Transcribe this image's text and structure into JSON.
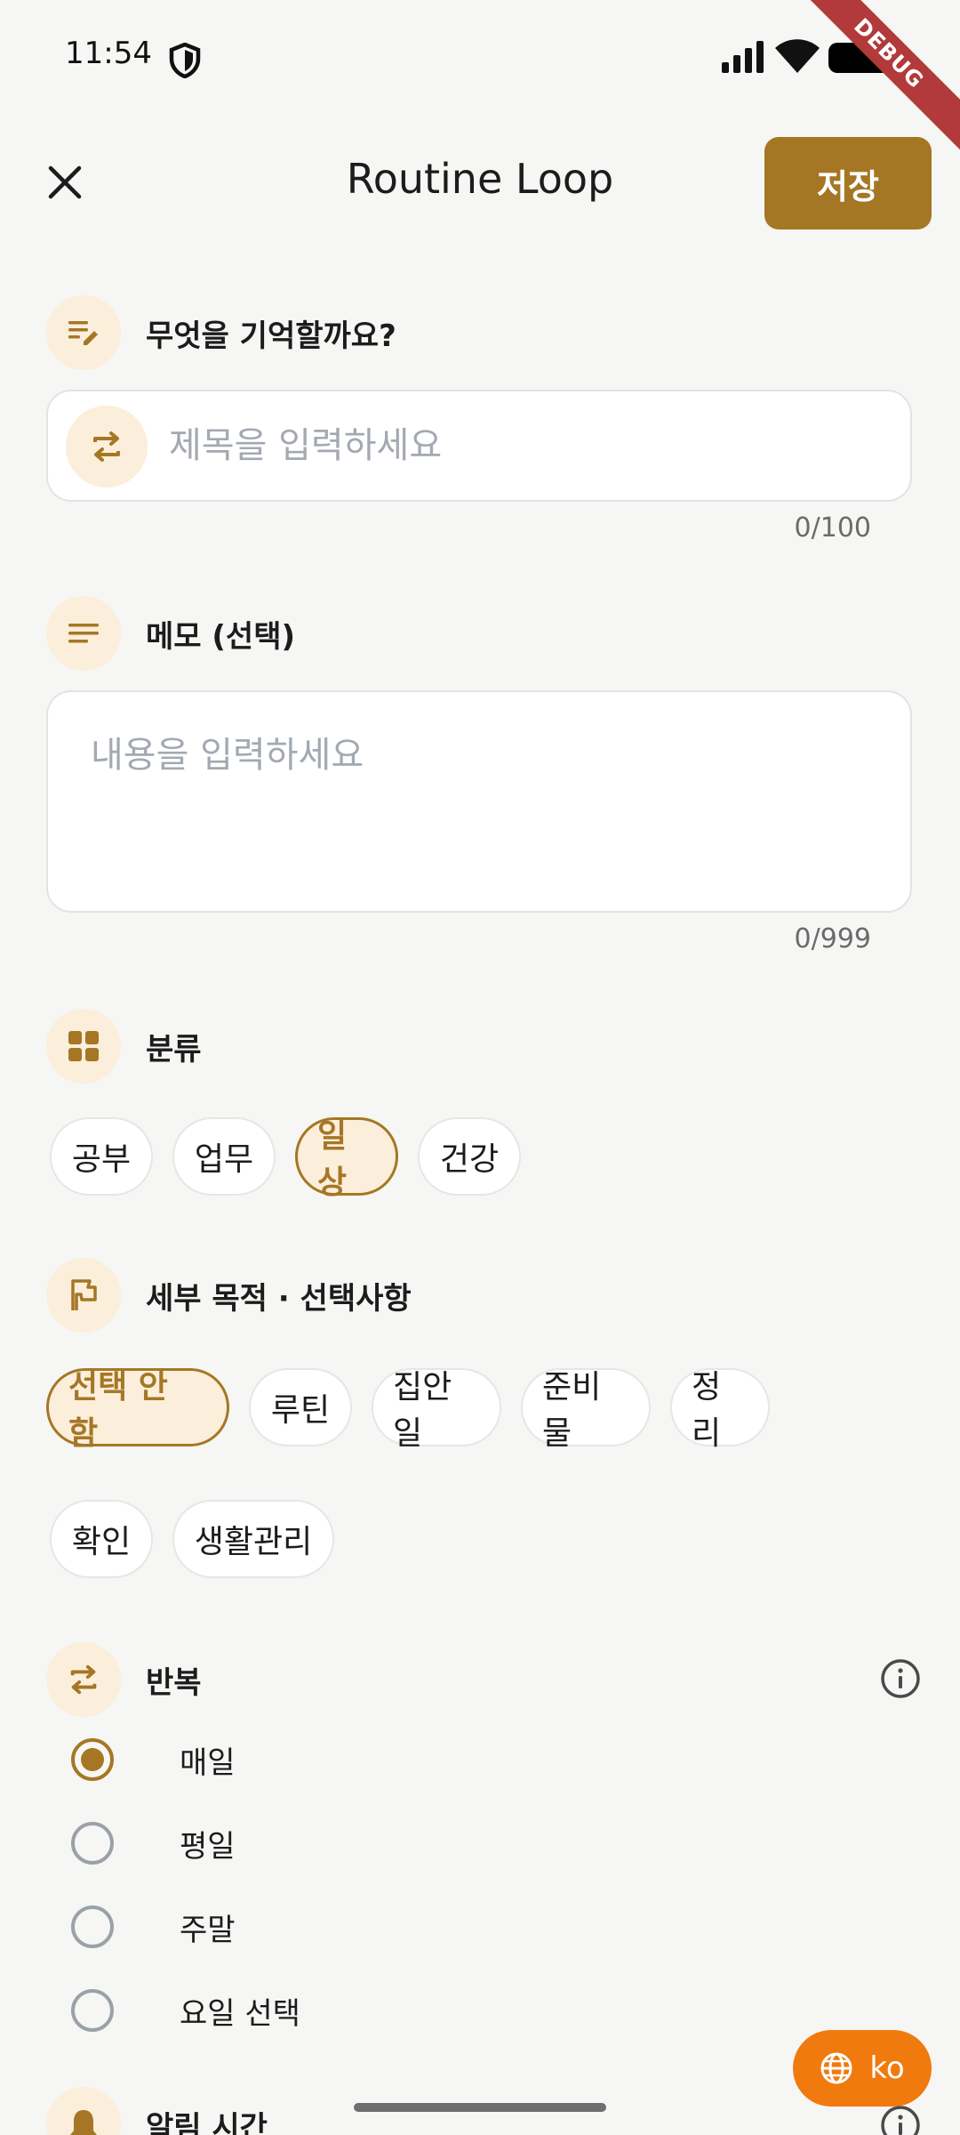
{
  "status_bar": {
    "time": "11:54"
  },
  "debug_banner": "DEBUG",
  "app_bar": {
    "title": "Routine Loop",
    "save_label": "저장"
  },
  "title_section": {
    "label": "무엇을 기억할까요?",
    "placeholder": "제목을 입력하세요",
    "value": "",
    "counter": "0/100"
  },
  "memo_section": {
    "label": "메모 (선택)",
    "placeholder": "내용을 입력하세요",
    "value": "",
    "counter": "0/999"
  },
  "category_section": {
    "label": "분류",
    "chips": [
      {
        "label": "공부",
        "selected": false
      },
      {
        "label": "업무",
        "selected": false
      },
      {
        "label": "일상",
        "selected": true
      },
      {
        "label": "건강",
        "selected": false
      }
    ]
  },
  "purpose_section": {
    "label": "세부 목적 · 선택사항",
    "chips_row1": [
      {
        "label": "선택 안 함",
        "selected": true
      },
      {
        "label": "루틴",
        "selected": false
      },
      {
        "label": "집안일",
        "selected": false
      },
      {
        "label": "준비물",
        "selected": false
      },
      {
        "label": "정리",
        "selected": false
      }
    ],
    "chips_row2": [
      {
        "label": "확인",
        "selected": false
      },
      {
        "label": "생활관리",
        "selected": false
      }
    ]
  },
  "repeat_section": {
    "label": "반복",
    "options": [
      {
        "label": "매일",
        "checked": true
      },
      {
        "label": "평일",
        "checked": false
      },
      {
        "label": "주말",
        "checked": false
      },
      {
        "label": "요일 선택",
        "checked": false
      }
    ]
  },
  "alarm_section": {
    "label": "알림 시간"
  },
  "language_button": {
    "label": "ko"
  },
  "colors": {
    "accent": "#A57725",
    "accent_soft": "#FBEEDB",
    "fab": "#F07A0E",
    "background": "#F6F6F4"
  }
}
